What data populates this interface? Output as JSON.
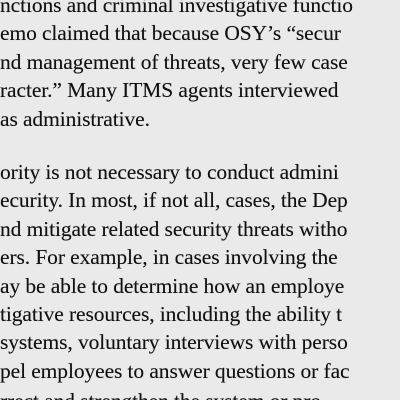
{
  "document": {
    "paragraphs": [
      {
        "lines": [
          "nctions and criminal investigative functio",
          "emo claimed that because OSY’s “secur",
          "nd management of threats, very few case",
          "racter.” Many ITMS agents interviewed",
          "as administrative."
        ]
      },
      {
        "lines": [
          "ority is not necessary to conduct admini",
          "ecurity. In most, if not all, cases, the Dep",
          "nd mitigate related security threats witho",
          "ers. For example, in cases involving the",
          "ay be able to determine how an employe",
          "tigative resources, including the ability t",
          "systems, voluntary interviews with perso",
          "pel employees to answer questions or fac",
          "rrect and strengthen the system or pro"
        ]
      }
    ]
  }
}
